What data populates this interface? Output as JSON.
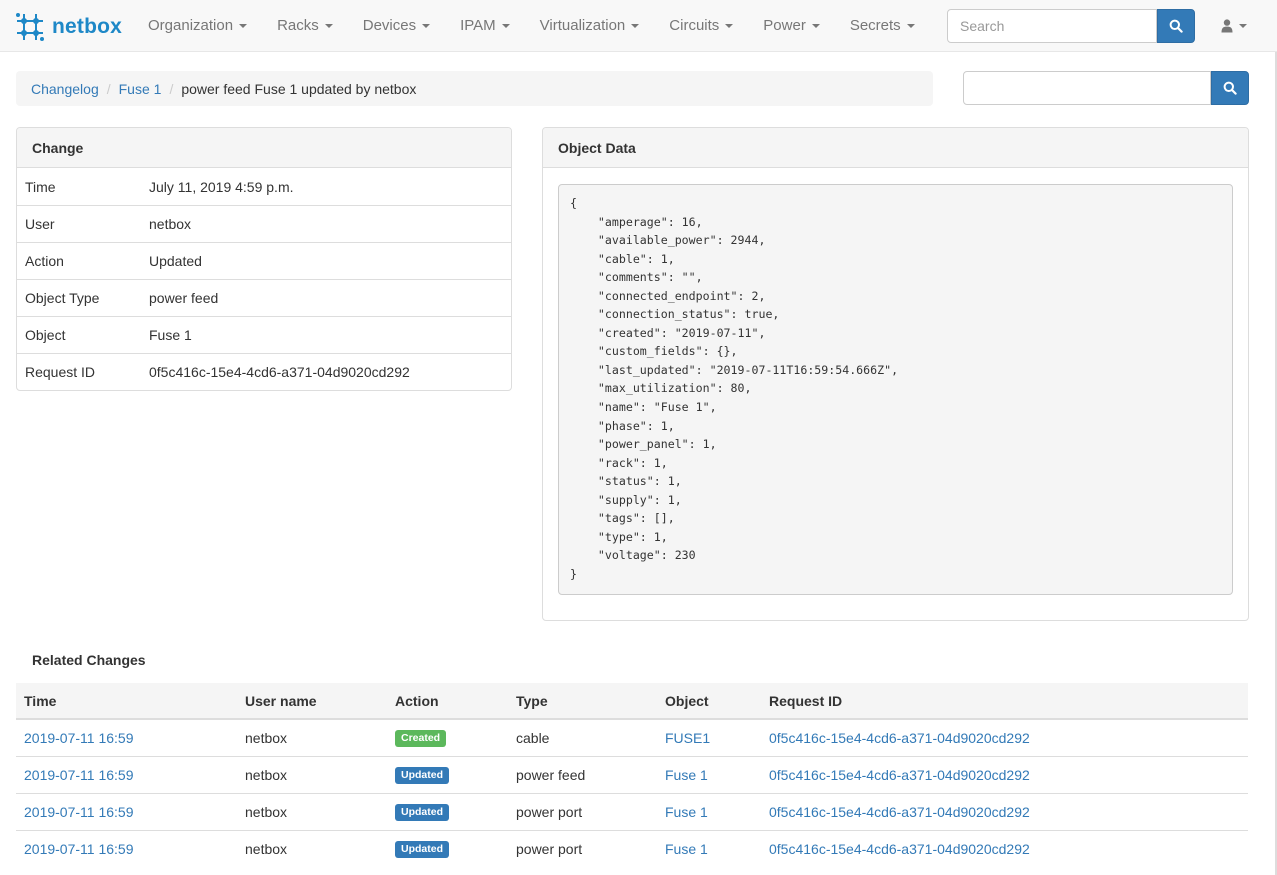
{
  "navbar": {
    "brand": "netbox",
    "menus": [
      {
        "label": "Organization"
      },
      {
        "label": "Racks"
      },
      {
        "label": "Devices"
      },
      {
        "label": "IPAM"
      },
      {
        "label": "Virtualization"
      },
      {
        "label": "Circuits"
      },
      {
        "label": "Power"
      },
      {
        "label": "Secrets"
      }
    ],
    "search_placeholder": "Search",
    "search_icon": "search-icon",
    "user_icon": "user-icon"
  },
  "breadcrumb": {
    "items": [
      "Changelog",
      "Fuse 1"
    ],
    "active": "power feed Fuse 1 updated by netbox"
  },
  "side_search": {
    "value": "",
    "icon": "search-icon"
  },
  "change_panel": {
    "title": "Change",
    "rows": [
      {
        "label": "Time",
        "value": "July 11, 2019 4:59 p.m."
      },
      {
        "label": "User",
        "value": "netbox"
      },
      {
        "label": "Action",
        "value": "Updated"
      },
      {
        "label": "Object Type",
        "value": "power feed"
      },
      {
        "label": "Object",
        "value": "Fuse 1"
      },
      {
        "label": "Request ID",
        "value": "0f5c416c-15e4-4cd6-a371-04d9020cd292"
      }
    ]
  },
  "object_panel": {
    "title": "Object Data",
    "json_text": "{\n    \"amperage\": 16,\n    \"available_power\": 2944,\n    \"cable\": 1,\n    \"comments\": \"\",\n    \"connected_endpoint\": 2,\n    \"connection_status\": true,\n    \"created\": \"2019-07-11\",\n    \"custom_fields\": {},\n    \"last_updated\": \"2019-07-11T16:59:54.666Z\",\n    \"max_utilization\": 80,\n    \"name\": \"Fuse 1\",\n    \"phase\": 1,\n    \"power_panel\": 1,\n    \"rack\": 1,\n    \"status\": 1,\n    \"supply\": 1,\n    \"tags\": [],\n    \"type\": 1,\n    \"voltage\": 230\n}"
  },
  "related_changes": {
    "title": "Related Changes",
    "columns": [
      "Time",
      "User name",
      "Action",
      "Type",
      "Object",
      "Request ID"
    ],
    "rows": [
      {
        "time": "2019-07-11 16:59",
        "user": "netbox",
        "action": "Created",
        "type": "cable",
        "object": "FUSE1",
        "request_id": "0f5c416c-15e4-4cd6-a371-04d9020cd292"
      },
      {
        "time": "2019-07-11 16:59",
        "user": "netbox",
        "action": "Updated",
        "type": "power feed",
        "object": "Fuse 1",
        "request_id": "0f5c416c-15e4-4cd6-a371-04d9020cd292"
      },
      {
        "time": "2019-07-11 16:59",
        "user": "netbox",
        "action": "Updated",
        "type": "power port",
        "object": "Fuse 1",
        "request_id": "0f5c416c-15e4-4cd6-a371-04d9020cd292"
      },
      {
        "time": "2019-07-11 16:59",
        "user": "netbox",
        "action": "Updated",
        "type": "power port",
        "object": "Fuse 1",
        "request_id": "0f5c416c-15e4-4cd6-a371-04d9020cd292"
      }
    ]
  },
  "colors": {
    "brand": "#1e88c7",
    "link": "#337ab7",
    "created_badge": "#5cb85c",
    "updated_badge": "#337ab7"
  }
}
